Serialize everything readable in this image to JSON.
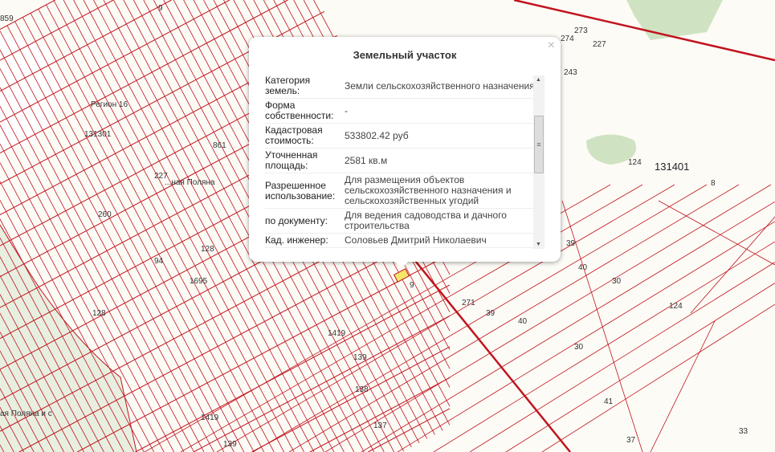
{
  "map": {
    "labels": [
      {
        "t": "859"
      },
      {
        "t": "9"
      },
      {
        "t": "Регион 16"
      },
      {
        "t": "131301"
      },
      {
        "t": "861"
      },
      {
        "t": "227"
      },
      {
        "t": "...ная Поляна"
      },
      {
        "t": "260"
      },
      {
        "t": "94"
      },
      {
        "t": "128"
      },
      {
        "t": "1695"
      },
      {
        "t": "128"
      },
      {
        "t": "1419"
      },
      {
        "t": "139"
      },
      {
        "t": "138"
      },
      {
        "t": "137"
      },
      {
        "t": "1419"
      },
      {
        "t": "139"
      },
      {
        "t": "9"
      },
      {
        "t": "271"
      },
      {
        "t": "39"
      },
      {
        "t": "40"
      },
      {
        "t": "30"
      },
      {
        "t": "39"
      },
      {
        "t": "40"
      },
      {
        "t": "30"
      },
      {
        "t": "124"
      },
      {
        "t": "131401"
      },
      {
        "t": "8"
      },
      {
        "t": "124"
      },
      {
        "t": "41"
      },
      {
        "t": "37"
      },
      {
        "t": "33"
      },
      {
        "t": "274"
      },
      {
        "t": "273"
      },
      {
        "t": "227"
      },
      {
        "t": "243"
      },
      {
        "t": "ая Поляна и с"
      }
    ],
    "colors": {
      "line": "#c0141e",
      "bg": "#fdfbf6",
      "green": "#cfe3c2",
      "highlight": "#f5e66a"
    }
  },
  "popup": {
    "title": "Земельный участок",
    "close": "×",
    "rows": [
      {
        "k": "Категория земель:",
        "v": "Земли сельскохозяйственного назначения"
      },
      {
        "k": "Форма собственности:",
        "v": "-"
      },
      {
        "k": "Кадастровая стоимость:",
        "v": "533802.42 руб"
      },
      {
        "k": "Уточненная площадь:",
        "v": "2581 кв.м"
      },
      {
        "k": "Разрешенное использование:",
        "v": "Для размещения объектов сельскохозяйственного назначения и сельскохозяйственных угодий"
      },
      {
        "k": "по документу:",
        "v": "Для ведения садоводства и дачного строительства"
      },
      {
        "k": "Кад. инженер:",
        "v": "Соловьев Дмитрий Николаевич"
      }
    ]
  }
}
